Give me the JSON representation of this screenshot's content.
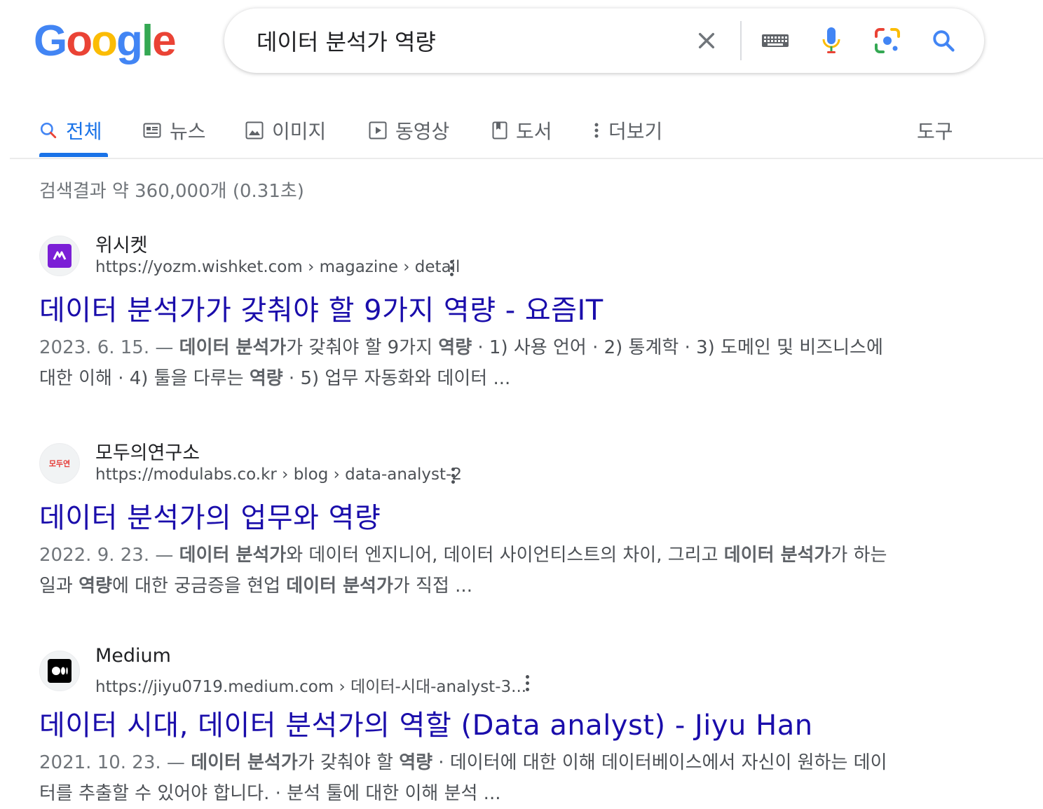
{
  "logo": {
    "letters": [
      "G",
      "o",
      "o",
      "g",
      "l",
      "e"
    ],
    "colors": [
      "#4285F4",
      "#EA4335",
      "#FBBC05",
      "#4285F4",
      "#34A853",
      "#EA4335"
    ]
  },
  "search": {
    "query": "데이터 분석가 역량"
  },
  "tabs": [
    {
      "label": "전체",
      "icon": "search-icon"
    },
    {
      "label": "뉴스",
      "icon": "news-icon"
    },
    {
      "label": "이미지",
      "icon": "image-icon"
    },
    {
      "label": "동영상",
      "icon": "video-icon"
    },
    {
      "label": "도서",
      "icon": "book-icon"
    },
    {
      "label": "더보기",
      "icon": "more-vert-icon"
    }
  ],
  "tools_label": "도구",
  "stats": "검색결과 약 360,000개 (0.31초)",
  "results": [
    {
      "site": "위시켓",
      "url": "https://yozm.wishket.com › magazine › detail",
      "title": "데이터 분석가가 갖춰야 할 9가지 역량 - 요즘IT",
      "date": "2023. 6. 15. — ",
      "snippet_parts": [
        {
          "t": "데이터 분석가",
          "b": true
        },
        {
          "t": "가 갖춰야 할 9가지 ",
          "b": false
        },
        {
          "t": "역량",
          "b": true
        },
        {
          "t": " · 1) 사용 언어 · 2) 통계학 · 3) 도메인 및 비즈니스에 대한 이해 · 4) 툴을 다루는 ",
          "b": false
        },
        {
          "t": "역량",
          "b": true
        },
        {
          "t": " · 5) 업무 자동화와 데이터 ...",
          "b": false
        }
      ]
    },
    {
      "site": "모두의연구소",
      "url": "https://modulabs.co.kr › blog › data-analyst-2",
      "title": "데이터 분석가의 업무와 역량",
      "date": "2022. 9. 23. — ",
      "snippet_parts": [
        {
          "t": "데이터 분석가",
          "b": true
        },
        {
          "t": "와 데이터 엔지니어, 데이터 사이언티스트의 차이, 그리고 ",
          "b": false
        },
        {
          "t": "데이터 분석가",
          "b": true
        },
        {
          "t": "가 하는 일과 ",
          "b": false
        },
        {
          "t": "역량",
          "b": true
        },
        {
          "t": "에 대한 궁금증을 현업 ",
          "b": false
        },
        {
          "t": "데이터 분석가",
          "b": true
        },
        {
          "t": "가 직접 ...",
          "b": false
        }
      ]
    },
    {
      "site": "Medium",
      "url": "https://jiyu0719.medium.com › 데이터-시대-analyst-3...",
      "title": "데이터 시대, 데이터 분석가의 역할 (Data analyst) - Jiyu Han",
      "date": "2021. 10. 23. — ",
      "snippet_parts": [
        {
          "t": "데이터 분석가",
          "b": true
        },
        {
          "t": "가 갖춰야 할 ",
          "b": false
        },
        {
          "t": "역량",
          "b": true
        },
        {
          "t": " · 데이터에 대한 이해 데이터베이스에서 자신이 원하는 데이터를 추출할 수 있어야 합니다. · 분석 툴에 대한 이해 분석 ...",
          "b": false
        }
      ]
    }
  ],
  "favicons": [
    {
      "icon": "wishket-logo-icon",
      "bg": "#7b1fd6"
    },
    {
      "icon": "modulabs-logo-icon",
      "text": "모두연",
      "color": "#e53935"
    },
    {
      "icon": "medium-logo-icon",
      "bg": "#000000"
    }
  ]
}
